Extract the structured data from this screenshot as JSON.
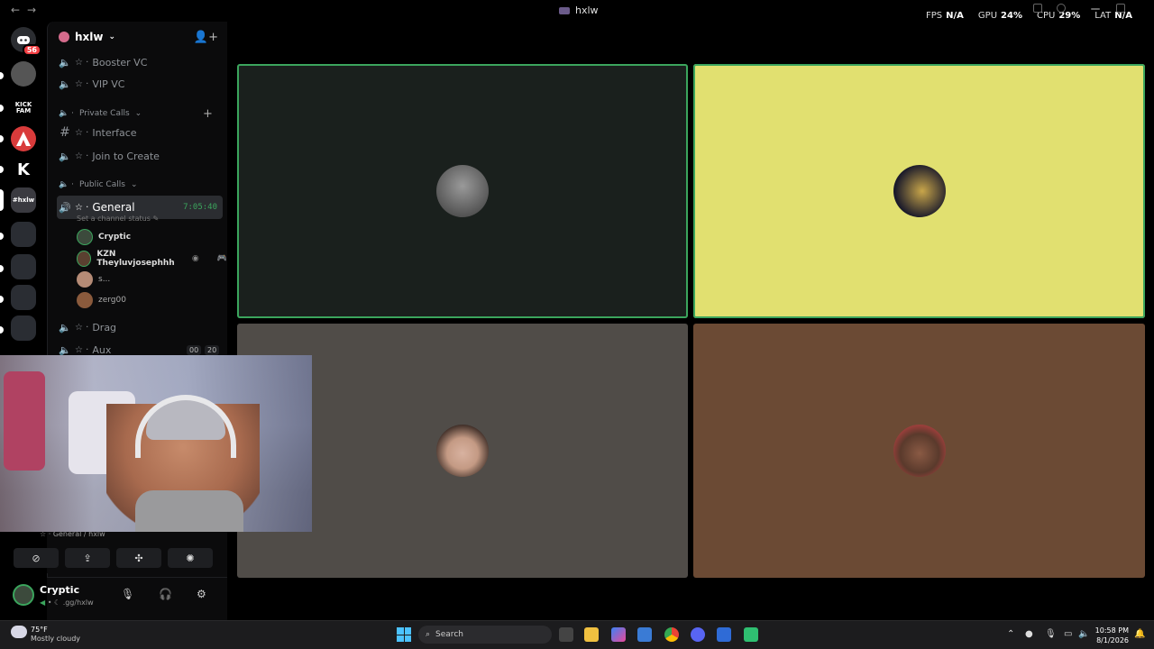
{
  "titlebar": {
    "back_label": "←",
    "forward_label": "→",
    "title": "hxlw",
    "stats": [
      {
        "label": "FPS",
        "value": "N/A"
      },
      {
        "label": "GPU",
        "value": "24%"
      },
      {
        "label": "CPU",
        "value": "29%"
      },
      {
        "label": "LAT",
        "value": "N/A"
      }
    ]
  },
  "rail": {
    "home_badge": "56",
    "servers": [
      {
        "name": "server-1",
        "text": "",
        "color": "#555"
      },
      {
        "name": "kick-fam",
        "text": "KICK FAM",
        "color": "#000"
      },
      {
        "name": "apex",
        "text": "A",
        "color": "#d93b3b"
      },
      {
        "name": "k-server",
        "text": "K",
        "color": "#000"
      },
      {
        "name": "hxlw",
        "text": "#hxlw",
        "color": "#3a3a40"
      },
      {
        "name": "folder-1",
        "text": "",
        "color": "#2a2d33"
      },
      {
        "name": "folder-2",
        "text": "",
        "color": "#2a2d33"
      },
      {
        "name": "folder-3",
        "text": "",
        "color": "#2a2d33"
      },
      {
        "name": "folder-4",
        "text": "",
        "color": "#2a2d33"
      }
    ]
  },
  "sidebar": {
    "server_name": "hxlw",
    "channels_top": [
      {
        "name": "Booster VC"
      },
      {
        "name": "VIP VC"
      }
    ],
    "category_private": "Private Calls",
    "channels_private": [
      {
        "name": "Interface",
        "type": "text"
      },
      {
        "name": "Join to Create",
        "type": "voice"
      }
    ],
    "category_public": "Public Calls",
    "active_channel": {
      "name": "General",
      "timer": "7:05:40",
      "status": "Set a channel status"
    },
    "members": [
      {
        "name": "Cryptic"
      },
      {
        "name": "KZN Theyluvjosephhh"
      },
      {
        "name": "s..."
      },
      {
        "name": "zerg00"
      }
    ],
    "channels_bottom": [
      {
        "name": "Drag"
      },
      {
        "name": "Aux",
        "count_a": "00",
        "count_b": "20"
      }
    ]
  },
  "voice_panel": {
    "location": "General / hxlw"
  },
  "user_panel": {
    "username": "Cryptic",
    "subtext": ".gg/hxlw"
  },
  "stage": {
    "tiles": [
      {
        "id": "tile-1",
        "bg": "#1a201d",
        "avatar": "#6b6b6b",
        "speaking": true
      },
      {
        "id": "tile-2",
        "bg": "#e1e070",
        "avatar": "#3a2e22",
        "speaking": true
      },
      {
        "id": "tile-3",
        "bg": "#504c48",
        "avatar": "#c49a84",
        "speaking": false
      },
      {
        "id": "tile-4",
        "bg": "#6b4a34",
        "avatar": "#8a5a44",
        "speaking": false
      }
    ]
  },
  "taskbar": {
    "temperature": "75°F",
    "weather": "Mostly cloudy",
    "search_label": "Search",
    "time": "10:58 PM",
    "date": "8/1/2026"
  }
}
